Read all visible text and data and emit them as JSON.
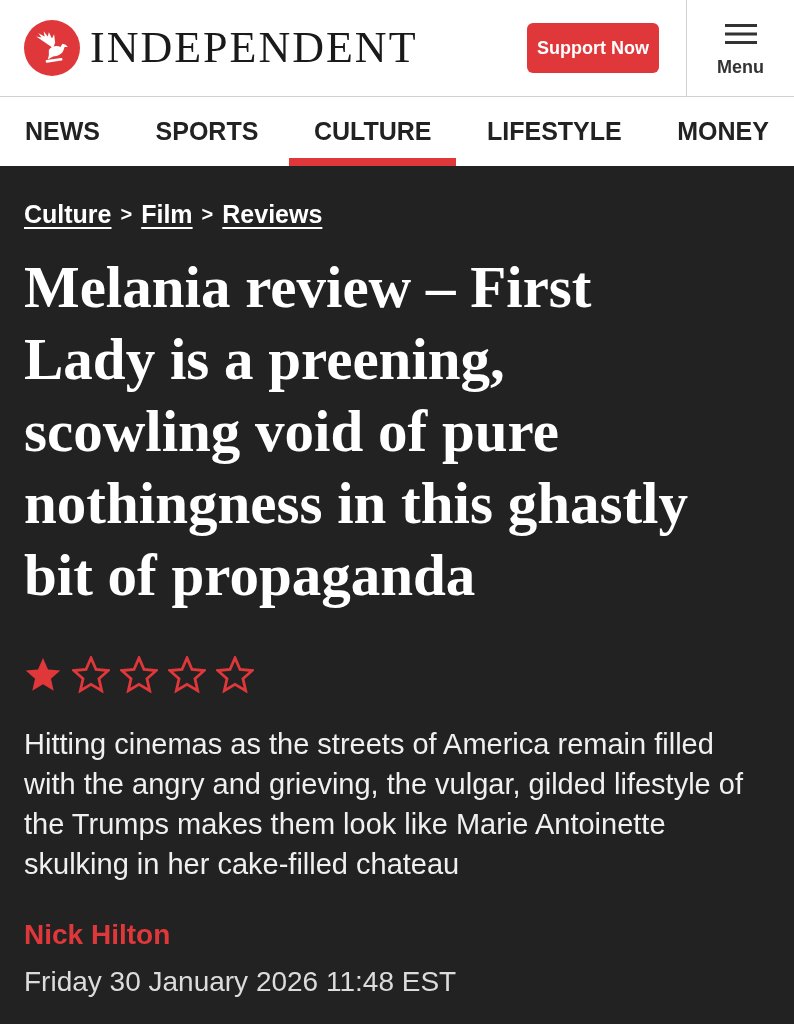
{
  "header": {
    "wordmark": "INDEPENDENT",
    "support_button": "Support Now",
    "menu_button": "Menu"
  },
  "nav": {
    "tabs": [
      {
        "label": "NEWS",
        "selected": false
      },
      {
        "label": "SPORTS",
        "selected": false
      },
      {
        "label": "CULTURE",
        "selected": true
      },
      {
        "label": "LIFESTYLE",
        "selected": false
      },
      {
        "label": "MONEY",
        "selected": false
      }
    ]
  },
  "article": {
    "breadcrumbs": [
      {
        "kind": "link",
        "text": "Culture"
      },
      {
        "kind": "separator",
        "text": ">"
      },
      {
        "kind": "link",
        "text": "Film"
      },
      {
        "kind": "separator",
        "text": ">"
      },
      {
        "kind": "link",
        "text": "Reviews"
      }
    ],
    "headline": "Melania review – First Lady is a preening, scowling void of pure nothingness in this ghastly bit of propaganda",
    "rating": {
      "stars": 1
    },
    "standfirst": "Hitting cinemas as the streets of America remain filled with the angry and grieving, the vulgar, gilded lifestyle of the Trumps makes them look like Marie Antoinette skulking in her cake-filled chateau",
    "byline": {
      "author": "Nick Hilton",
      "date": "Friday 30 January 2026 11:48 EST"
    }
  }
}
